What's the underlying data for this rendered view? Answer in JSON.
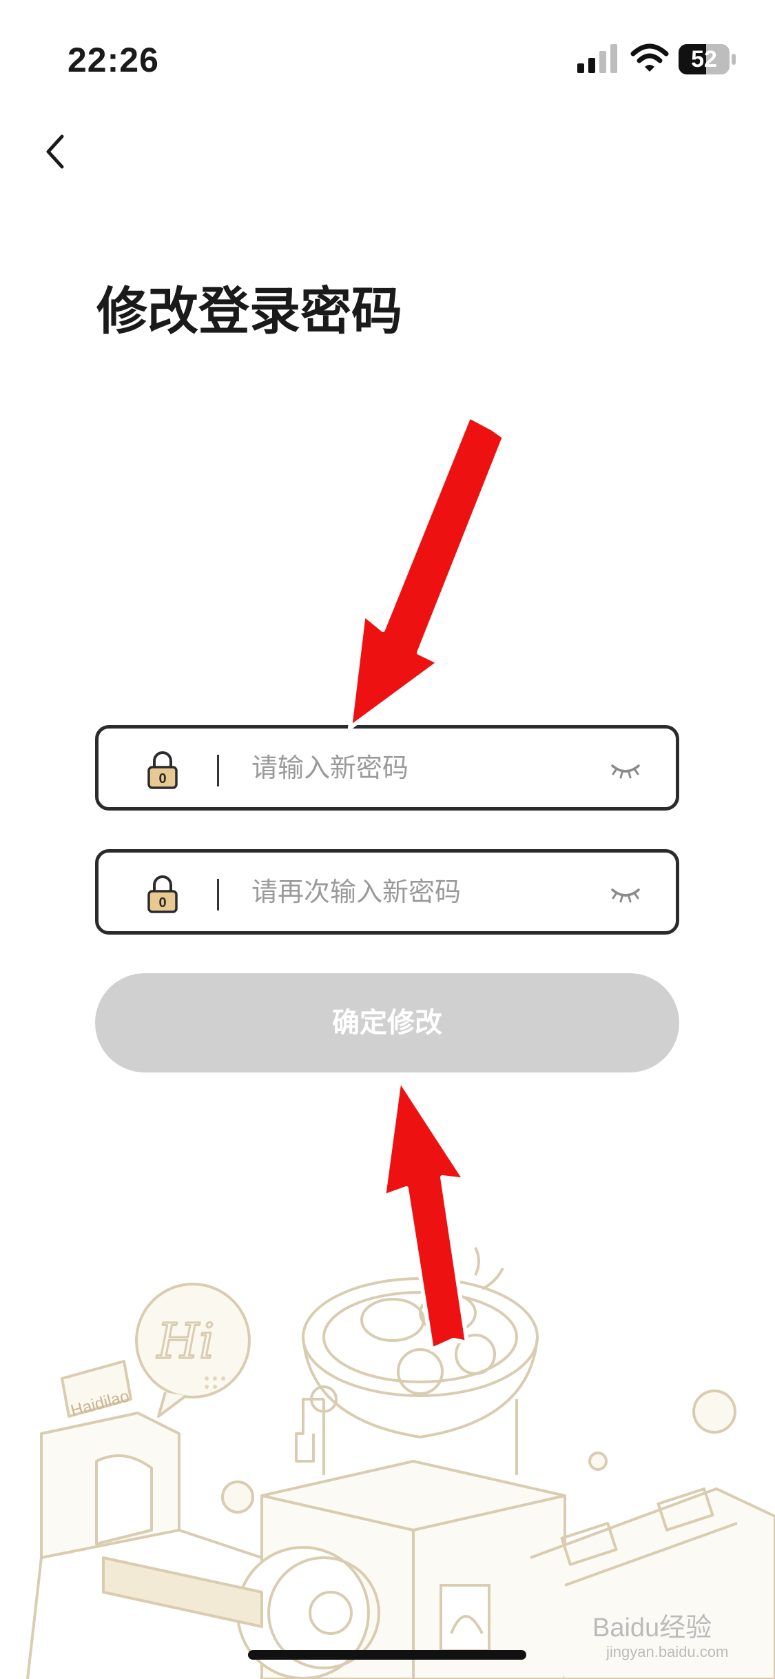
{
  "status_bar": {
    "time": "22:26",
    "battery": "52"
  },
  "header": {
    "back_icon": "chevron-left-icon"
  },
  "page": {
    "title": "修改登录密码"
  },
  "form": {
    "new_password": {
      "placeholder": "请输入新密码",
      "icon": "lock-icon",
      "toggle_icon": "eye-closed-icon"
    },
    "confirm_password": {
      "placeholder": "请再次输入新密码",
      "icon": "lock-icon",
      "toggle_icon": "eye-closed-icon"
    },
    "submit_label": "确定修改"
  },
  "illustration": {
    "sign_text": "Haidilao"
  },
  "watermark": {
    "text": "Baidu经验",
    "sub": "jingyan.baidu.com"
  },
  "colors": {
    "accent_disabled": "#d0d0d0",
    "border": "#2b2b2b",
    "lock_fill": "#e8c992",
    "illustration_line": "#d9ccb0",
    "arrow": "#ee1111"
  }
}
